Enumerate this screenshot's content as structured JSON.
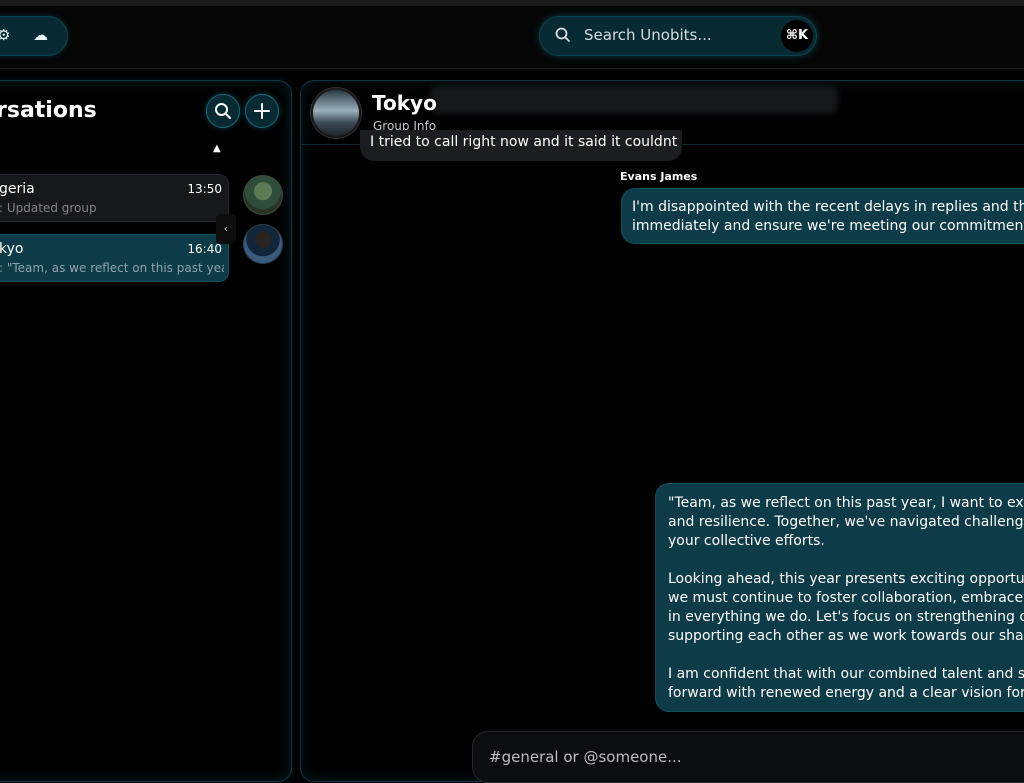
{
  "topbar": {
    "search": {
      "placeholder": "Search Unobits...",
      "shortcut": "⌘K"
    },
    "tool_icons": [
      "settings-icon",
      "cloud-icon"
    ]
  },
  "sidebar": {
    "title": "rsations",
    "conversations": [
      {
        "name": "geria",
        "time": "13:50",
        "preview": ": Updated group"
      },
      {
        "name": "kyo",
        "time": "16:40",
        "preview": ": \"Team, as we reflect on this past yea..."
      }
    ],
    "collapse_symbol": "‹",
    "sort_symbol": "▲"
  },
  "chat": {
    "title": "Tokyo",
    "subtitle": "Group Info",
    "messages": {
      "partial": "I tried to call right now and it said it couldnt",
      "sender": "Evans James",
      "m1_line1": "I'm disappointed with the recent delays in replies and the",
      "m1_line2": "immediately and ensure we're meeting our commitments",
      "m2_p1_l1": "\"Team, as we reflect on this past year, I want to exten",
      "m2_p1_l2": "and resilience. Together, we've navigated challenges",
      "m2_p1_l3": "your collective efforts.",
      "m2_p2_l1": "Looking ahead, this year presents exciting opportun",
      "m2_p2_l2": "we must continue to foster collaboration, embrace n",
      "m2_p2_l3": "in everything we do. Let's focus on strengthening ou",
      "m2_p2_l4": "supporting each other as we work towards our share",
      "m2_p3_l1": "I am confident that with our combined talent and sp",
      "m2_p3_l2": "forward with renewed energy and a clear vision for s"
    },
    "composer": {
      "placeholder": "#general or @someone..."
    }
  },
  "colors": {
    "accent": "#0d3b48",
    "accent_border": "#13515f",
    "background": "#000000",
    "bubble_gray": "#1b1d20"
  }
}
